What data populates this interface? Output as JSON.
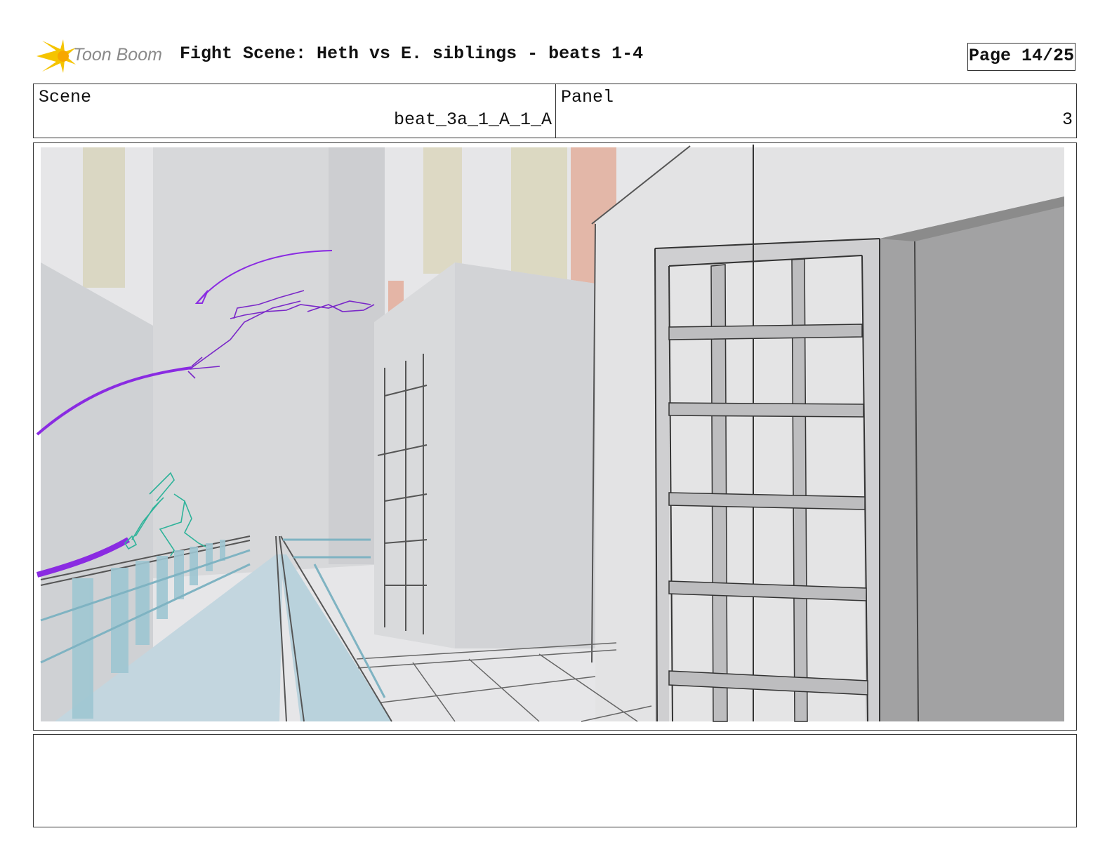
{
  "header": {
    "logo_text": "Toon Boom",
    "title": "Fight Scene: Heth vs E. siblings - beats 1-4",
    "page": "Page 14/25"
  },
  "info": {
    "scene_label": "Scene",
    "scene_value": "beat_3a_1_A_1_A",
    "panel_label": "Panel",
    "panel_value": "3"
  },
  "notes": {
    "text": ""
  },
  "colors": {
    "accent_purple": "#8a2be2",
    "sketch_teal": "#2fb39a",
    "bridge_blue": "#a8cdd8",
    "logo_yellow": "#f5c400"
  }
}
